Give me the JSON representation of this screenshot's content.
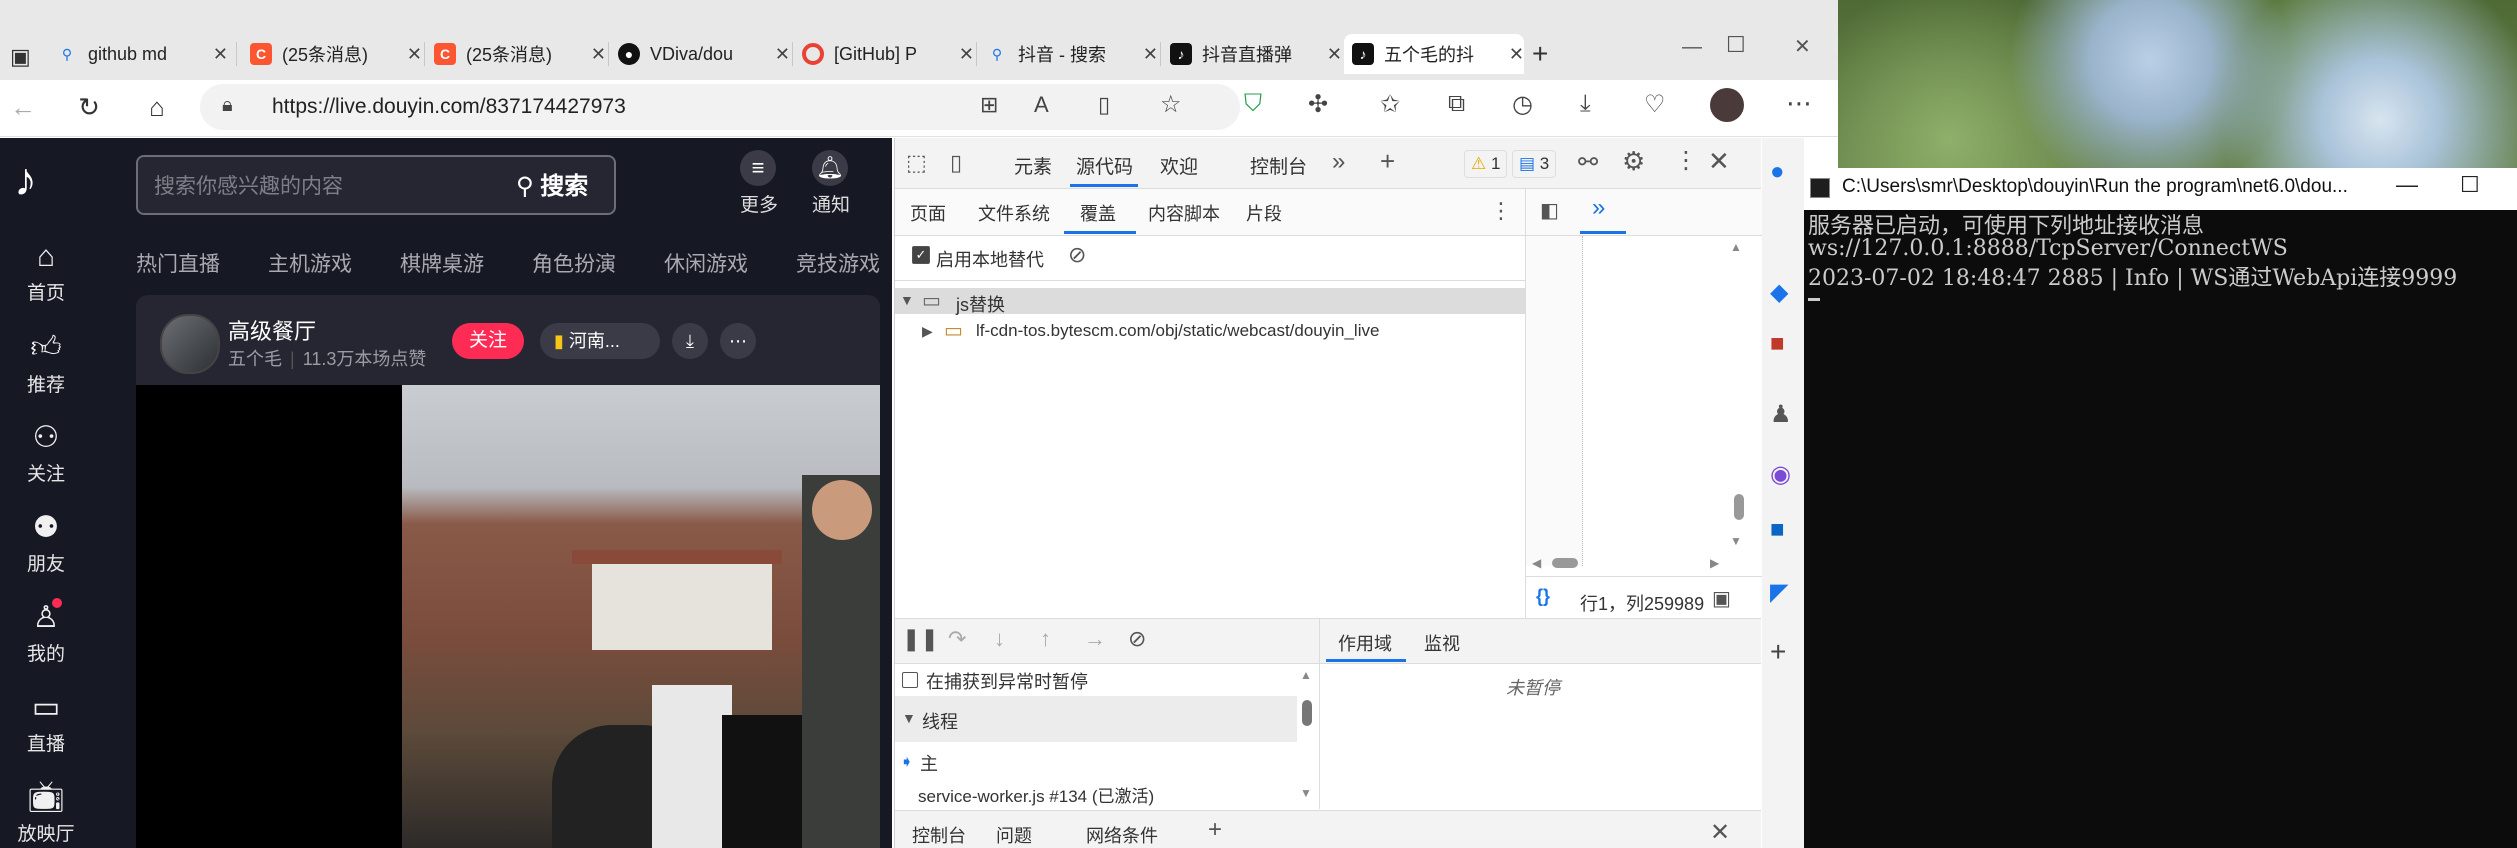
{
  "tabs": [
    {
      "label": "github md",
      "favicon": "search-icon",
      "color": "#1a73e8"
    },
    {
      "label": "(25条消息)",
      "favicon": "csdn-icon",
      "color": "#fc5531"
    },
    {
      "label": "(25条消息)",
      "favicon": "csdn-icon",
      "color": "#fc5531"
    },
    {
      "label": "VDiva/dou",
      "favicon": "github-icon",
      "color": "#111111"
    },
    {
      "label": "[GitHub] P",
      "favicon": "chrome-icon",
      "color": "#e94235"
    },
    {
      "label": "抖音 - 搜索",
      "favicon": "search-icon",
      "color": "#1a73e8"
    },
    {
      "label": "抖音直播弹",
      "favicon": "tiktok-icon",
      "color": "#111111"
    },
    {
      "label": "五个毛的抖",
      "favicon": "tiktok-icon",
      "color": "#111111"
    }
  ],
  "address": {
    "url": "https://live.douyin.com/837174427973"
  },
  "douyin": {
    "search_placeholder": "搜索你感兴趣的内容",
    "search_button": "搜索",
    "top_actions": [
      "更多",
      "通知"
    ],
    "sidebar": [
      "首页",
      "推荐",
      "关注",
      "朋友",
      "我的",
      "直播",
      "放映厅"
    ],
    "categories": [
      "热门直播",
      "主机游戏",
      "棋牌桌游",
      "角色扮演",
      "休闲游戏",
      "竞技游戏"
    ],
    "room": {
      "title": "高级餐厅",
      "host": "五个毛",
      "likes": "11.3万本场点赞",
      "follow": "关注",
      "location_badge": "河南..."
    }
  },
  "devtools": {
    "main_tabs": [
      "元素",
      "源代码",
      "欢迎",
      "控制台"
    ],
    "warnings": "1",
    "messages": "3",
    "sub_tabs": [
      "页面",
      "文件系统",
      "覆盖",
      "内容脚本",
      "片段"
    ],
    "override_checkbox": "启用本地替代",
    "tree": {
      "folder": "js替换",
      "child": "lf-cdn-tos.bytescm.com/obj/static/webcast/douyin_live"
    },
    "status": "行1，列259989",
    "pause_exception": "在捕获到异常时暂停",
    "threads": "线程",
    "thread_main": "主",
    "thread_worker": "service-worker.js #134 (已激活)",
    "scope_tabs": [
      "作用域",
      "监视"
    ],
    "not_paused": "未暂停",
    "drawer_tabs": [
      "控制台",
      "问题",
      "网络条件"
    ]
  },
  "console": {
    "title": "C:\\Users\\smr\\Desktop\\douyin\\Run the program\\net6.0\\dou...",
    "lines": [
      "服务器已启动，可使用下列地址接收消息",
      "ws://127.0.0.1:8888/TcpServer/ConnectWS",
      "2023-07-02 18:48:47 2885 | Info | WS通过WebApi连接9999"
    ]
  }
}
